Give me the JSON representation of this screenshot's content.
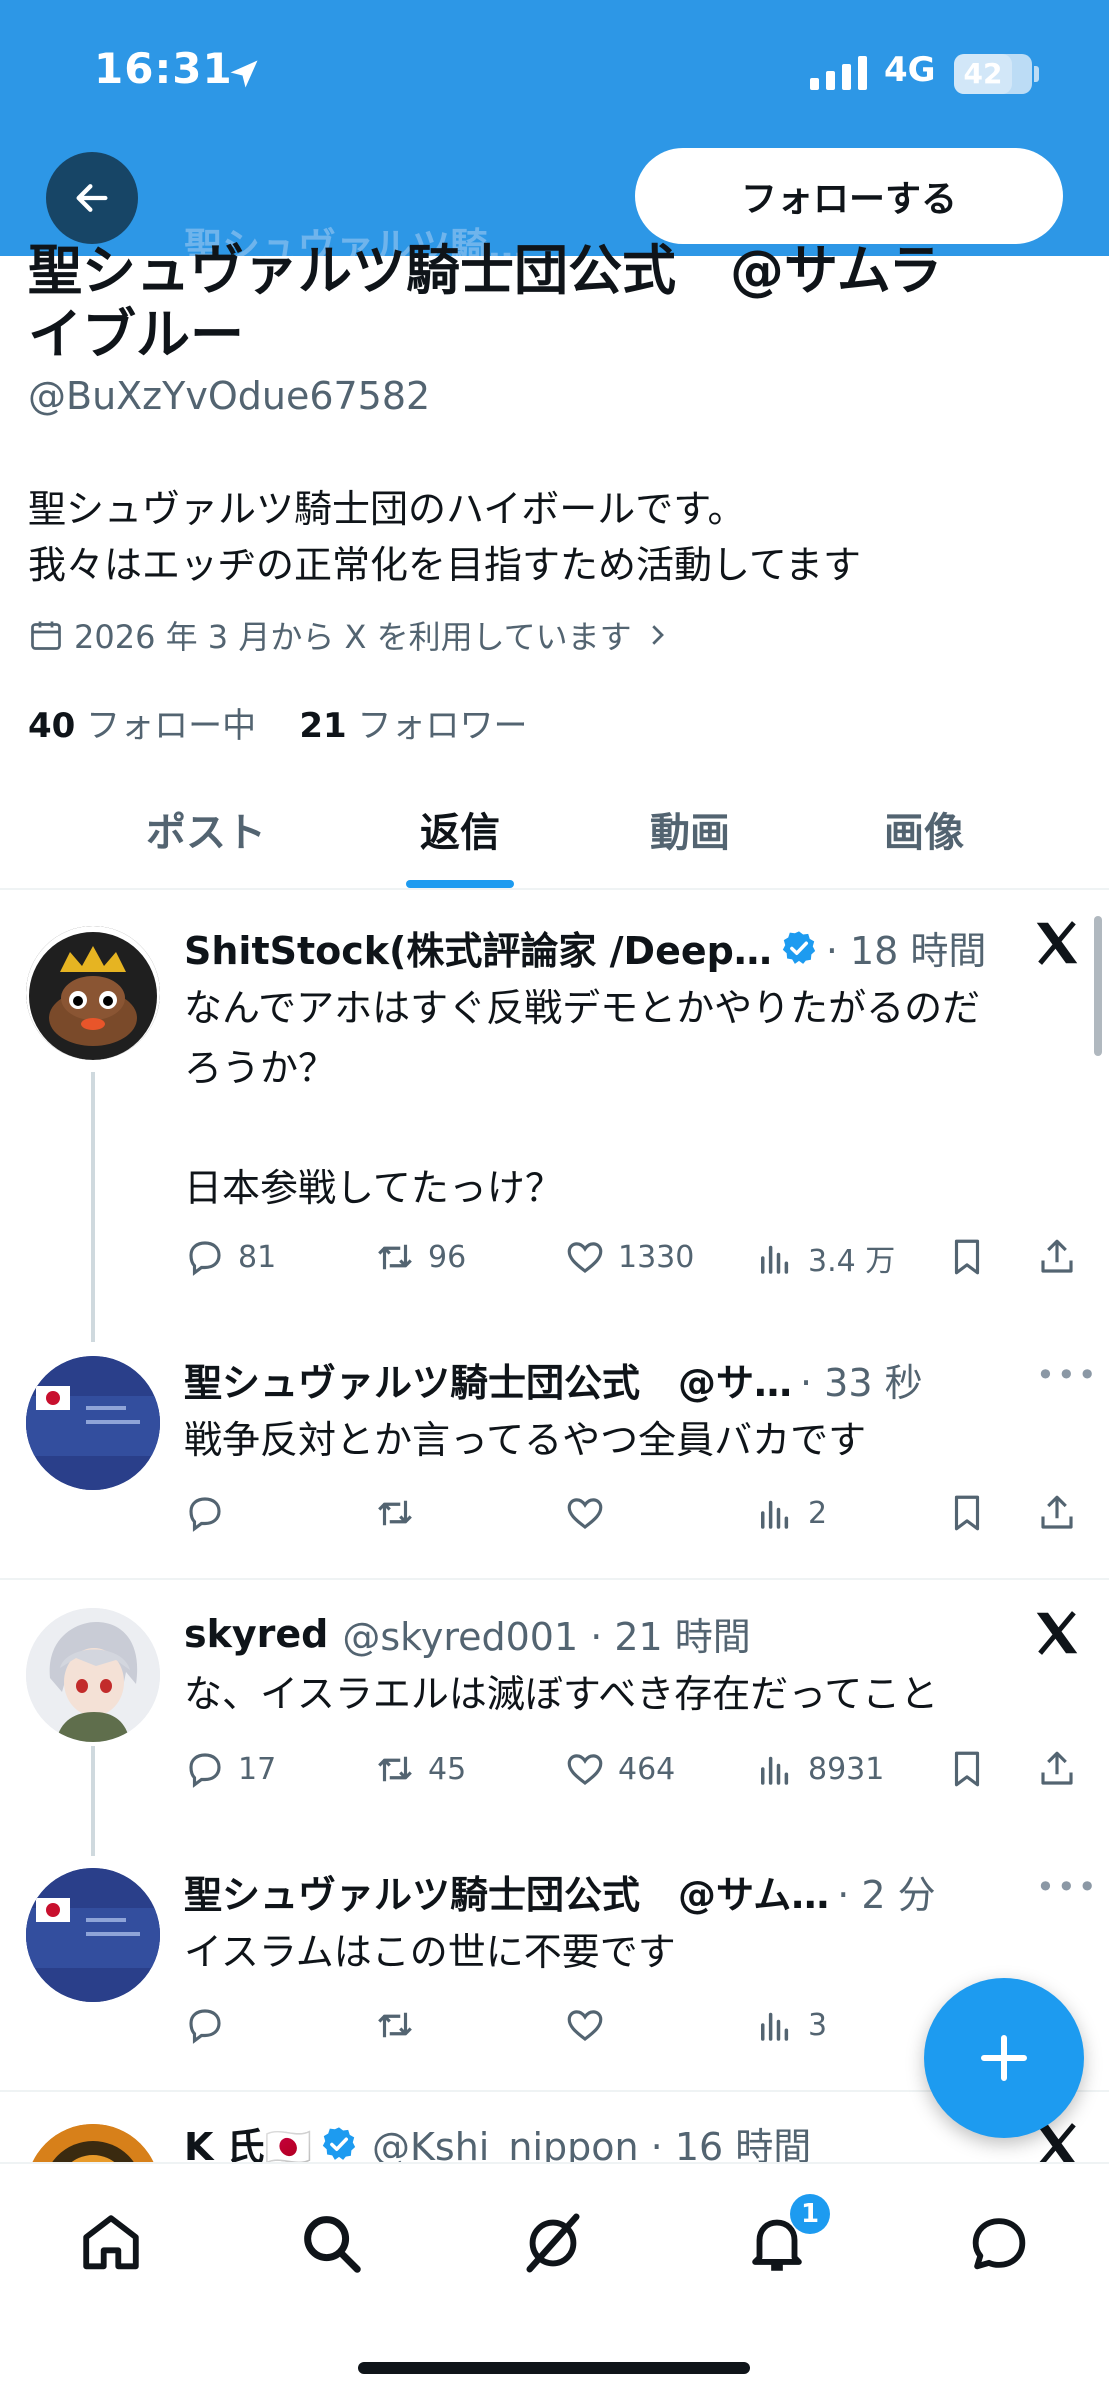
{
  "status_bar": {
    "time": "16:31",
    "network": "4G",
    "battery": "42"
  },
  "header": {
    "faded_title": "聖シュヴァルツ騎…",
    "follow_label": "フォローする"
  },
  "profile": {
    "name_line1": "聖シュヴァルツ騎士団公式　@サムラ",
    "name_line2": "イブルー",
    "handle": "@BuXzYvOdue67582",
    "bio_line1": "聖シュヴァルツ騎士団のハイボールです。",
    "bio_line2": "我々はエッヂの正常化を目指すため活動してます",
    "joined": "2026 年 3 月から X を利用しています",
    "following_count": "40",
    "following_label": "フォロー中",
    "followers_count": "21",
    "followers_label": "フォロワー"
  },
  "tabs": [
    "ポスト",
    "返信",
    "動画",
    "画像"
  ],
  "posts": [
    {
      "name": "ShitStock(株式評論家 /Deep…",
      "meta": "· 18 時間",
      "verified": true,
      "lines": [
        "なんでアホはすぐ反戦デモとかやりたがるのだ",
        "ろうか？",
        "",
        "日本参戦してたっけ？"
      ],
      "replies": "81",
      "reposts": "96",
      "likes": "1330",
      "views": "3.4 万"
    },
    {
      "name": "聖シュヴァルツ騎士団公式　@サ…",
      "meta": "· 33 秒",
      "lines": [
        "戦争反対とか言ってるやつ全員バカです"
      ],
      "replies": "",
      "reposts": "",
      "likes": "",
      "views": "2"
    },
    {
      "name": "skyred",
      "meta": "@skyred001 · 21 時間",
      "lines": [
        "な、イスラエルは滅ぼすべき存在だってこと"
      ],
      "replies": "17",
      "reposts": "45",
      "likes": "464",
      "views": "8931"
    },
    {
      "name": "聖シュヴァルツ騎士団公式　@サム…",
      "meta": "· 2 分",
      "lines": [
        "イスラムはこの世に不要です"
      ],
      "replies": "",
      "reposts": "",
      "likes": "",
      "views": "3"
    },
    {
      "name": "K 氏🇯🇵",
      "meta": "@Kshi_nippon · 16 時間",
      "verified": true
    }
  ],
  "bottom_nav": {
    "items": [
      "home-icon",
      "search-icon",
      "grok-icon",
      "bell-icon",
      "messages-icon"
    ],
    "notification_count": "1"
  },
  "colors": {
    "header": "#2d97e6",
    "accent": "#1d9bf0",
    "muted": "#536471"
  }
}
